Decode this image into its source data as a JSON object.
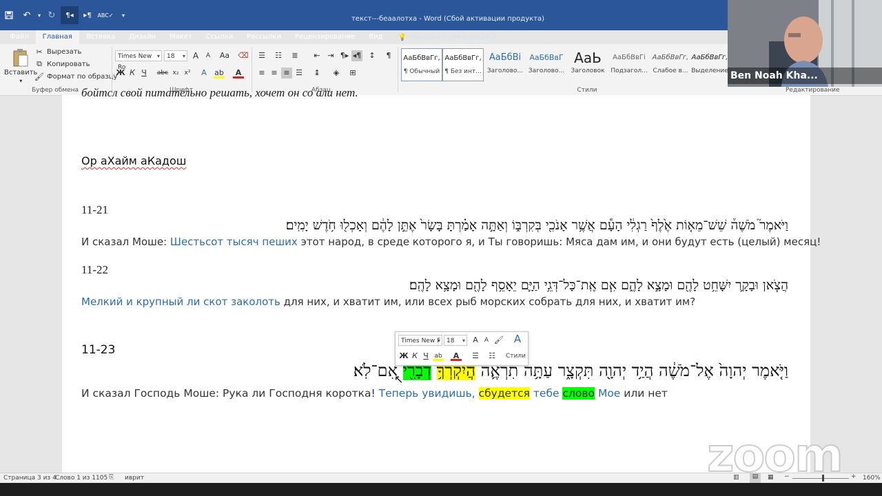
{
  "window": {
    "title": "текст---беаалотха - Word (Сбой активации продукта)"
  },
  "qat": {
    "save_icon": "save-icon",
    "undo_icon": "undo-icon",
    "redo_icon": "redo-icon",
    "rtl_icon": "rtl-paragraph-icon",
    "ltr_icon": "ltr-paragraph-icon",
    "spell_icon": "spelling-icon",
    "customize_icon": "customize-qat-icon"
  },
  "tabs": [
    "Файл",
    "Главная",
    "Вставка",
    "Дизайн",
    "Макет",
    "Ссылки",
    "Рассылки",
    "Рецензирование",
    "Вид"
  ],
  "tellme": "Что вы хотите сделать?",
  "clipboard": {
    "paste": "Вставить",
    "cut": "Вырезать",
    "copy": "Копировать",
    "format_painter": "Формат по образцу",
    "group": "Буфер обмена"
  },
  "font": {
    "name": "Times New Ro",
    "size": "18",
    "grow": "A",
    "shrink": "A",
    "case": "Aa",
    "bold": "Ж",
    "italic": "К",
    "underline": "Ч",
    "strike": "abc",
    "sub": "x₂",
    "sup": "x²",
    "group": "Шрифт"
  },
  "paragraph": {
    "group": "Абзац"
  },
  "styles": {
    "group": "Стили",
    "items": [
      {
        "preview": "АаБбВвГг,",
        "name": "¶ Обычный"
      },
      {
        "preview": "АаБбВвГг,",
        "name": "¶ Без инт..."
      },
      {
        "preview": "АаБбВі",
        "name": "Заголово..."
      },
      {
        "preview": "АаБбВвГ",
        "name": "Заголово..."
      },
      {
        "preview": "АаЬ",
        "name": "Заголовок"
      },
      {
        "preview": "АаБбВвГі",
        "name": "Подзагол..."
      },
      {
        "preview": "АаБбВвГг,",
        "name": "Слабое в..."
      },
      {
        "preview": "АаБбВвГг,",
        "name": "Выделение"
      }
    ]
  },
  "editing": {
    "group": "Редактирование"
  },
  "webcam": {
    "name": "Ben Noah Kha..."
  },
  "document": {
    "top_cut": "бойтсл свой питательно решать, хочет он со али нет.",
    "heading": "Ор аХайм аКадош",
    "blocks": [
      {
        "num": "11-21",
        "heb": "וַיֹּאמֶר֮ מֹשֶׁה֒ שֵׁשׁ־מֵא֤וֹת אֶ֙לֶף֙ רַגְלִ֔י הָעָ֕ם אֲשֶׁ֥ר אָנֹכִ֖י בְּקִרְבּ֑וֹ וְאַתָּ֣ה אָמַ֗רְתָּ בָּשָׂר֙ אֶתֵּ֣ן לָהֶ֔ם וְאָכְל֖וּ חֹ֥דֶשׁ יָמִֽים׃",
        "ru_pre": "И сказал Моше: ",
        "ru_blue": "Шестьсот тысяч пеших",
        "ru_post": " этот народ, в среде которого я, и Ты говоришь: Мяса дам им, и они будут есть (целый) месяц!"
      },
      {
        "num": "11-22",
        "heb": "הֲצֹ֧אן וּבָקָ֛ר יִשָּׁחֵ֥ט לָהֶ֖ם וּמָצָ֣א לָהֶ֑ם אִ֧ם אֶֽת־כָּל־דְּגֵ֥י הַיָּ֛ם יֵאָסֵ֥ף לָהֶ֖ם וּמָצָ֥א לָהֶֽם׃",
        "ru_blue": "Мелкий и крупный ли скот заколоть",
        "ru_post": " для них, и хватит им, или всех рыб морских собрать для них, и хватит им?"
      },
      {
        "num": "11-23",
        "heb_main": "וַיֹּ֤אמֶר יְהוָה֙ אֶל־מֹשֶׁ֔ה הֲיַ֥ד יְהוָ֖ה תִּקְצָ֑ר עַתָּ֥ה תִרְאֶ֛ה ",
        "heb_yellow": "הֲיִקְרְךָ֥",
        "heb_green": "דְבָרִ֖י",
        "heb_end": " אִם־לֹֽא׃",
        "ru_pre": "И сказал Господь Моше: Рука ли Господня коротка! ",
        "ru_blue1": "Теперь увидишь, ",
        "ru_yellow": "сбудется",
        "ru_blue2": " тебе ",
        "ru_green": "слово",
        "ru_blue3": " Мое",
        "ru_post": " или нет"
      }
    ]
  },
  "minitoolbar": {
    "font": "Times New F",
    "size": "18",
    "styles": "Стили"
  },
  "status": {
    "page": "Страница 3 из 4",
    "words": "Слово 1 из 1105",
    "lang": "иврит",
    "zoom": "160%"
  },
  "watermark": "zoom",
  "colors": {
    "ribbon_blue": "#2b579a",
    "text_blue": "#2b6cb0",
    "highlight_yellow": "#ffff00",
    "highlight_green": "#00ff00"
  }
}
